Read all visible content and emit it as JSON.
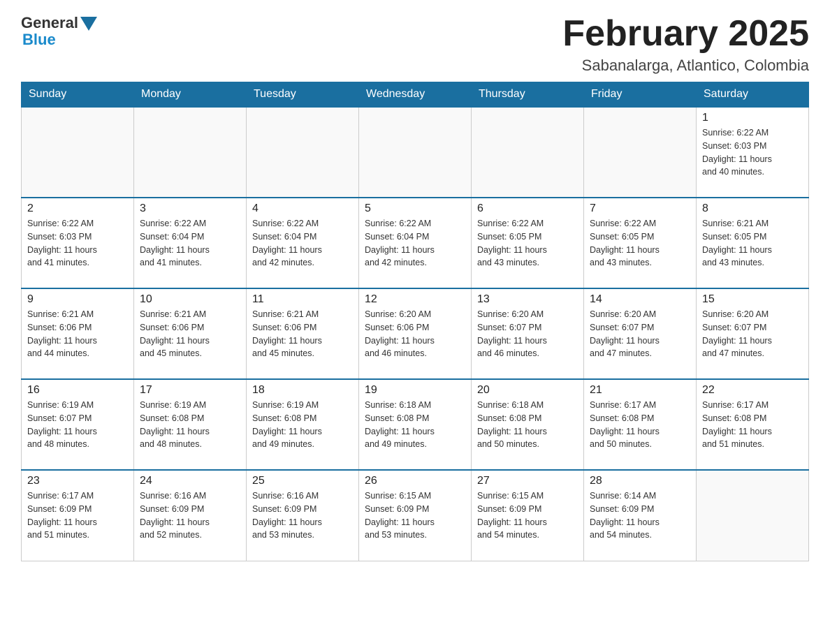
{
  "logo": {
    "general": "General",
    "blue": "Blue"
  },
  "title": "February 2025",
  "subtitle": "Sabanalarga, Atlantico, Colombia",
  "weekdays": [
    "Sunday",
    "Monday",
    "Tuesday",
    "Wednesday",
    "Thursday",
    "Friday",
    "Saturday"
  ],
  "weeks": [
    [
      {
        "day": "",
        "info": ""
      },
      {
        "day": "",
        "info": ""
      },
      {
        "day": "",
        "info": ""
      },
      {
        "day": "",
        "info": ""
      },
      {
        "day": "",
        "info": ""
      },
      {
        "day": "",
        "info": ""
      },
      {
        "day": "1",
        "info": "Sunrise: 6:22 AM\nSunset: 6:03 PM\nDaylight: 11 hours\nand 40 minutes."
      }
    ],
    [
      {
        "day": "2",
        "info": "Sunrise: 6:22 AM\nSunset: 6:03 PM\nDaylight: 11 hours\nand 41 minutes."
      },
      {
        "day": "3",
        "info": "Sunrise: 6:22 AM\nSunset: 6:04 PM\nDaylight: 11 hours\nand 41 minutes."
      },
      {
        "day": "4",
        "info": "Sunrise: 6:22 AM\nSunset: 6:04 PM\nDaylight: 11 hours\nand 42 minutes."
      },
      {
        "day": "5",
        "info": "Sunrise: 6:22 AM\nSunset: 6:04 PM\nDaylight: 11 hours\nand 42 minutes."
      },
      {
        "day": "6",
        "info": "Sunrise: 6:22 AM\nSunset: 6:05 PM\nDaylight: 11 hours\nand 43 minutes."
      },
      {
        "day": "7",
        "info": "Sunrise: 6:22 AM\nSunset: 6:05 PM\nDaylight: 11 hours\nand 43 minutes."
      },
      {
        "day": "8",
        "info": "Sunrise: 6:21 AM\nSunset: 6:05 PM\nDaylight: 11 hours\nand 43 minutes."
      }
    ],
    [
      {
        "day": "9",
        "info": "Sunrise: 6:21 AM\nSunset: 6:06 PM\nDaylight: 11 hours\nand 44 minutes."
      },
      {
        "day": "10",
        "info": "Sunrise: 6:21 AM\nSunset: 6:06 PM\nDaylight: 11 hours\nand 45 minutes."
      },
      {
        "day": "11",
        "info": "Sunrise: 6:21 AM\nSunset: 6:06 PM\nDaylight: 11 hours\nand 45 minutes."
      },
      {
        "day": "12",
        "info": "Sunrise: 6:20 AM\nSunset: 6:06 PM\nDaylight: 11 hours\nand 46 minutes."
      },
      {
        "day": "13",
        "info": "Sunrise: 6:20 AM\nSunset: 6:07 PM\nDaylight: 11 hours\nand 46 minutes."
      },
      {
        "day": "14",
        "info": "Sunrise: 6:20 AM\nSunset: 6:07 PM\nDaylight: 11 hours\nand 47 minutes."
      },
      {
        "day": "15",
        "info": "Sunrise: 6:20 AM\nSunset: 6:07 PM\nDaylight: 11 hours\nand 47 minutes."
      }
    ],
    [
      {
        "day": "16",
        "info": "Sunrise: 6:19 AM\nSunset: 6:07 PM\nDaylight: 11 hours\nand 48 minutes."
      },
      {
        "day": "17",
        "info": "Sunrise: 6:19 AM\nSunset: 6:08 PM\nDaylight: 11 hours\nand 48 minutes."
      },
      {
        "day": "18",
        "info": "Sunrise: 6:19 AM\nSunset: 6:08 PM\nDaylight: 11 hours\nand 49 minutes."
      },
      {
        "day": "19",
        "info": "Sunrise: 6:18 AM\nSunset: 6:08 PM\nDaylight: 11 hours\nand 49 minutes."
      },
      {
        "day": "20",
        "info": "Sunrise: 6:18 AM\nSunset: 6:08 PM\nDaylight: 11 hours\nand 50 minutes."
      },
      {
        "day": "21",
        "info": "Sunrise: 6:17 AM\nSunset: 6:08 PM\nDaylight: 11 hours\nand 50 minutes."
      },
      {
        "day": "22",
        "info": "Sunrise: 6:17 AM\nSunset: 6:08 PM\nDaylight: 11 hours\nand 51 minutes."
      }
    ],
    [
      {
        "day": "23",
        "info": "Sunrise: 6:17 AM\nSunset: 6:09 PM\nDaylight: 11 hours\nand 51 minutes."
      },
      {
        "day": "24",
        "info": "Sunrise: 6:16 AM\nSunset: 6:09 PM\nDaylight: 11 hours\nand 52 minutes."
      },
      {
        "day": "25",
        "info": "Sunrise: 6:16 AM\nSunset: 6:09 PM\nDaylight: 11 hours\nand 53 minutes."
      },
      {
        "day": "26",
        "info": "Sunrise: 6:15 AM\nSunset: 6:09 PM\nDaylight: 11 hours\nand 53 minutes."
      },
      {
        "day": "27",
        "info": "Sunrise: 6:15 AM\nSunset: 6:09 PM\nDaylight: 11 hours\nand 54 minutes."
      },
      {
        "day": "28",
        "info": "Sunrise: 6:14 AM\nSunset: 6:09 PM\nDaylight: 11 hours\nand 54 minutes."
      },
      {
        "day": "",
        "info": ""
      }
    ]
  ]
}
